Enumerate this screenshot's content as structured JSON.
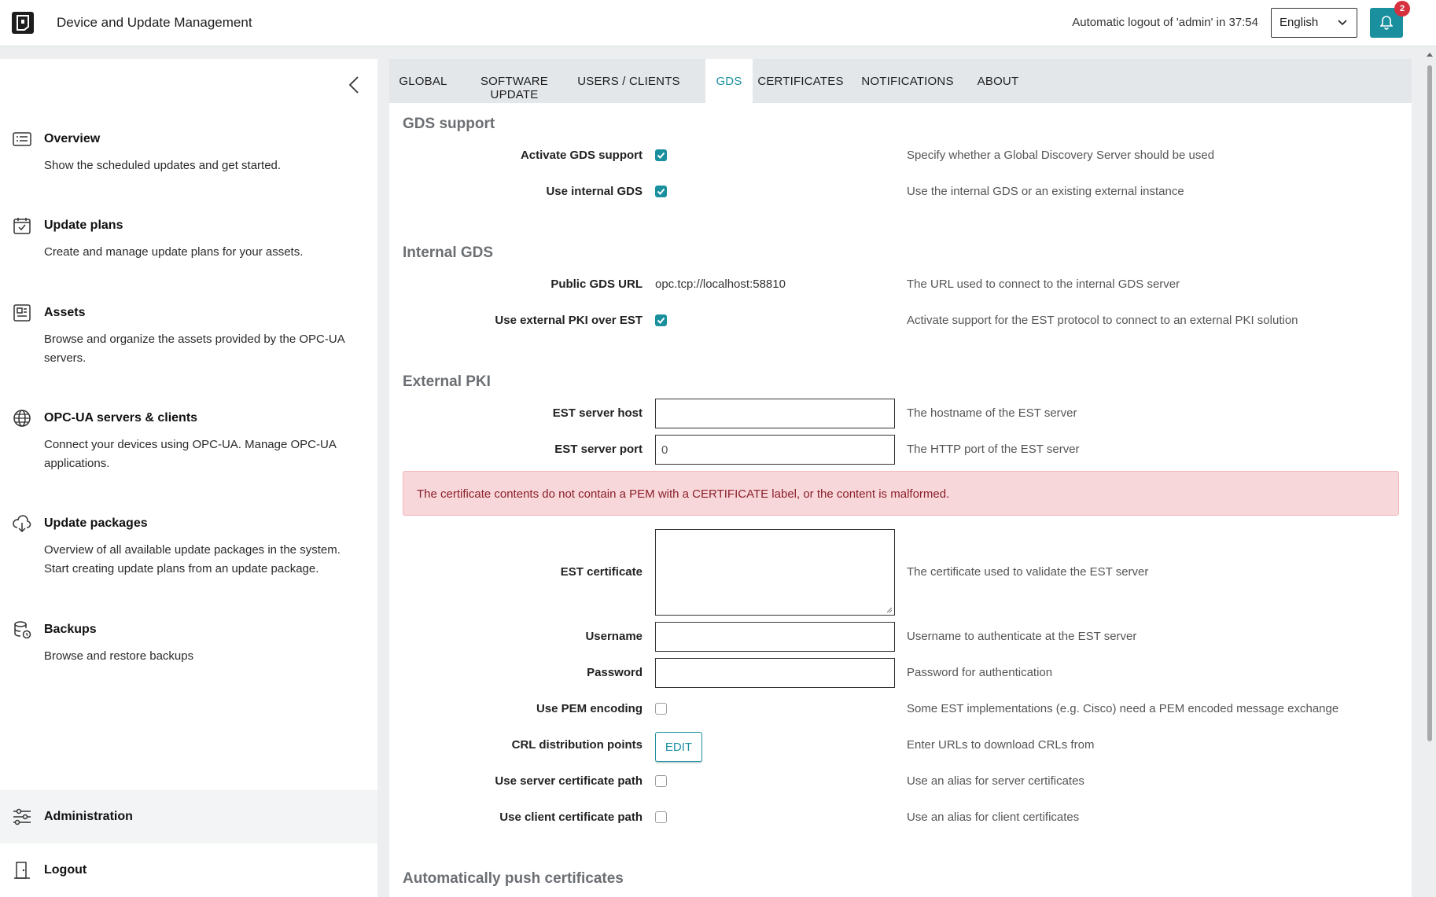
{
  "header": {
    "app_title": "Device and Update Management",
    "logout_notice": "Automatic logout of 'admin' in 37:54",
    "language": "English",
    "notification_count": "2"
  },
  "sidebar": {
    "items": [
      {
        "title": "Overview",
        "desc": "Show the scheduled updates and get started.",
        "icon": "list-icon"
      },
      {
        "title": "Update plans",
        "desc": "Create and manage update plans for your assets.",
        "icon": "calendar-check-icon"
      },
      {
        "title": "Assets",
        "desc": "Browse and organize the assets provided by the OPC-UA servers.",
        "icon": "asset-icon"
      },
      {
        "title": "OPC-UA servers & clients",
        "desc": "Connect your devices using OPC-UA. Manage OPC-UA applications.",
        "icon": "globe-icon"
      },
      {
        "title": "Update packages",
        "desc": "Overview of all available update packages in the system. Start creating update plans from an update package.",
        "icon": "cloud-download-icon"
      },
      {
        "title": "Backups",
        "desc": "Browse and restore backups",
        "icon": "database-clock-icon"
      }
    ],
    "admin_label": "Administration",
    "logout_label": "Logout"
  },
  "tabs": [
    "GLOBAL",
    "SOFTWARE UPDATE",
    "USERS / CLIENTS",
    "GDS",
    "CERTIFICATES",
    "NOTIFICATIONS",
    "ABOUT"
  ],
  "active_tab": "GDS",
  "gds_support": {
    "title": "GDS support",
    "activate_label": "Activate GDS support",
    "activate_help": "Specify whether a Global Discovery Server should be used",
    "activate_checked": true,
    "internal_label": "Use internal GDS",
    "internal_help": "Use the internal GDS or an existing external instance",
    "internal_checked": true
  },
  "internal_gds": {
    "title": "Internal GDS",
    "url_label": "Public GDS URL",
    "url_value": "opc.tcp://localhost:58810",
    "url_help": "The URL used to connect to the internal GDS server",
    "pki_label": "Use external PKI over EST",
    "pki_help": "Activate support for the EST protocol to connect to an external PKI solution",
    "pki_checked": true
  },
  "external_pki": {
    "title": "External PKI",
    "host_label": "EST server host",
    "host_value": "",
    "host_help": "The hostname of the EST server",
    "port_label": "EST server port",
    "port_value": "0",
    "port_help": "The HTTP port of the EST server",
    "error": "The certificate contents do not contain a PEM with a CERTIFICATE label, or the content is malformed.",
    "cert_label": "EST certificate",
    "cert_help": "The certificate used to validate the EST server",
    "user_label": "Username",
    "user_help": "Username to authenticate at the EST server",
    "pass_label": "Password",
    "pass_help": "Password for authentication",
    "pem_label": "Use PEM encoding",
    "pem_help": "Some EST implementations (e.g. Cisco) need a PEM encoded message exchange",
    "pem_checked": false,
    "crl_label": "CRL distribution points",
    "crl_button": "EDIT",
    "crl_help": "Enter URLs to download CRLs from",
    "server_path_label": "Use server certificate path",
    "server_path_help": "Use an alias for server certificates",
    "server_path_checked": false,
    "client_path_label": "Use client certificate path",
    "client_path_help": "Use an alias for client certificates",
    "client_path_checked": false
  },
  "auto_push": {
    "title": "Automatically push certificates"
  },
  "colors": {
    "accent": "#1a8f9e",
    "error_bg": "#f8d7da",
    "error_text": "#8a1f2a",
    "badge": "#d6303e"
  }
}
